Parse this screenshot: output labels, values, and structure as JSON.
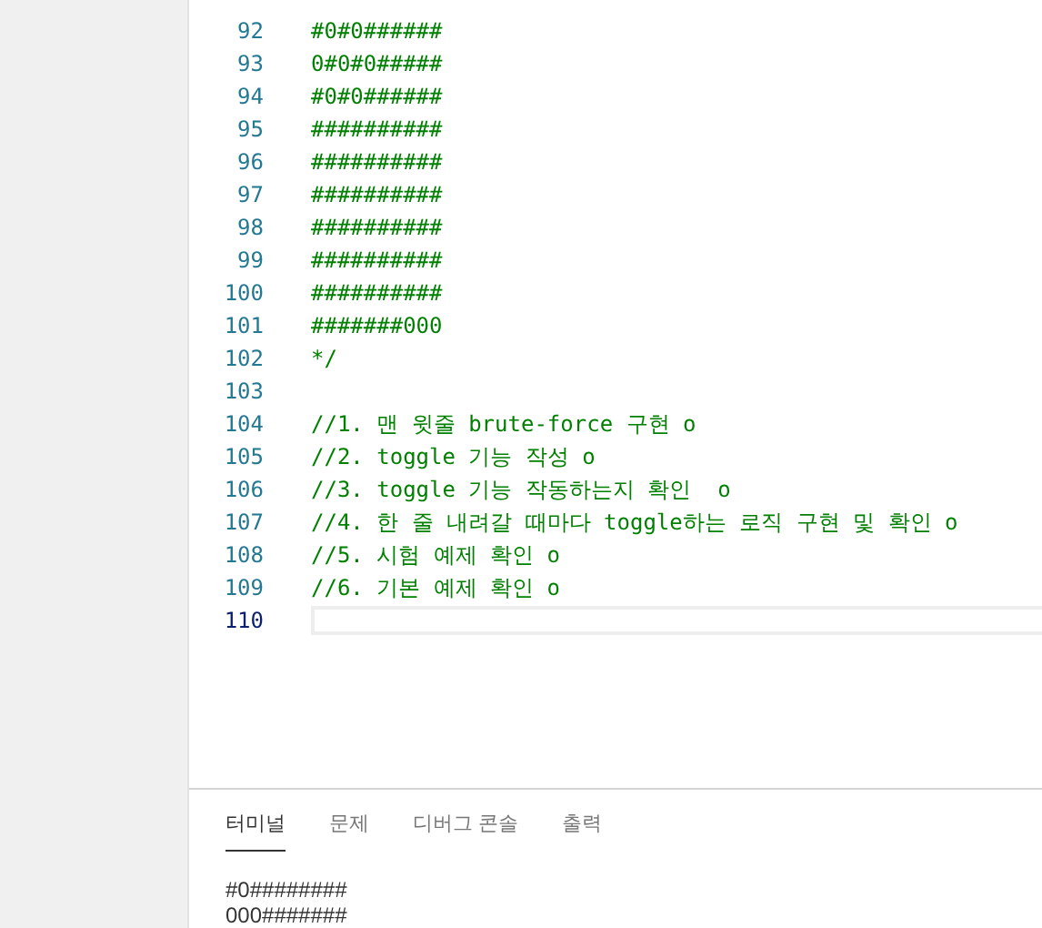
{
  "editor": {
    "lines": [
      {
        "number": "92",
        "text": "#0#0######",
        "current": false
      },
      {
        "number": "93",
        "text": "0#0#0#####",
        "current": false
      },
      {
        "number": "94",
        "text": "#0#0######",
        "current": false
      },
      {
        "number": "95",
        "text": "##########",
        "current": false
      },
      {
        "number": "96",
        "text": "##########",
        "current": false
      },
      {
        "number": "97",
        "text": "##########",
        "current": false
      },
      {
        "number": "98",
        "text": "##########",
        "current": false
      },
      {
        "number": "99",
        "text": "##########",
        "current": false
      },
      {
        "number": "100",
        "text": "##########",
        "current": false
      },
      {
        "number": "101",
        "text": "#######000",
        "current": false
      },
      {
        "number": "102",
        "text": "*/",
        "current": false
      },
      {
        "number": "103",
        "current": false
      },
      {
        "number": "104",
        "text": "//1. 맨 윗줄 brute-force 구현 o",
        "current": false
      },
      {
        "number": "105",
        "text": "//2. toggle 기능 작성 o",
        "current": false
      },
      {
        "number": "106",
        "text": "//3. toggle 기능 작동하는지 확인  o",
        "current": false
      },
      {
        "number": "107",
        "text": "//4. 한 줄 내려갈 때마다 toggle하는 로직 구현 및 확인 o",
        "current": false
      },
      {
        "number": "108",
        "text": "//5. 시험 예제 확인 o",
        "current": false
      },
      {
        "number": "109",
        "text": "//6. 기본 예제 확인 o",
        "current": false
      },
      {
        "number": "110",
        "current": true
      }
    ]
  },
  "panel": {
    "tabs": [
      {
        "label": "터미널",
        "selected": true
      },
      {
        "label": "문제",
        "selected": false
      },
      {
        "label": "디버그 콘솔",
        "selected": false
      },
      {
        "label": "출력",
        "selected": false
      }
    ],
    "output": [
      "#0########",
      "000#######"
    ]
  }
}
